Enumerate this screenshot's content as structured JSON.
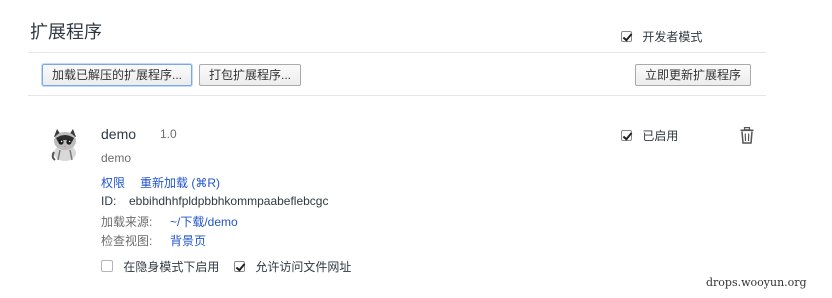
{
  "header": {
    "title": "扩展程序",
    "dev_mode_label": "开发者模式",
    "dev_mode_checked": true
  },
  "toolbar": {
    "load_unpacked_label": "加载已解压的扩展程序...",
    "pack_label": "打包扩展程序...",
    "update_now_label": "立即更新扩展程序"
  },
  "extension": {
    "name": "demo",
    "version": "1.0",
    "description": "demo",
    "permissions_link": "权限",
    "reload_link": "重新加载 (⌘R)",
    "id_label": "ID:",
    "id_value": "ebbihdhhfpldpbbhkommpaabeflebcgc",
    "load_source_label": "加载来源:",
    "load_source_value": "~/下载/demo",
    "inspect_label": "检查视图:",
    "inspect_link": "背景页",
    "enabled_label": "已启用",
    "enabled_checked": true,
    "incognito_label": "在隐身模式下启用",
    "incognito_checked": false,
    "file_access_label": "允许访问文件网址",
    "file_access_checked": true
  },
  "watermark": "drops.wooyun.org"
}
